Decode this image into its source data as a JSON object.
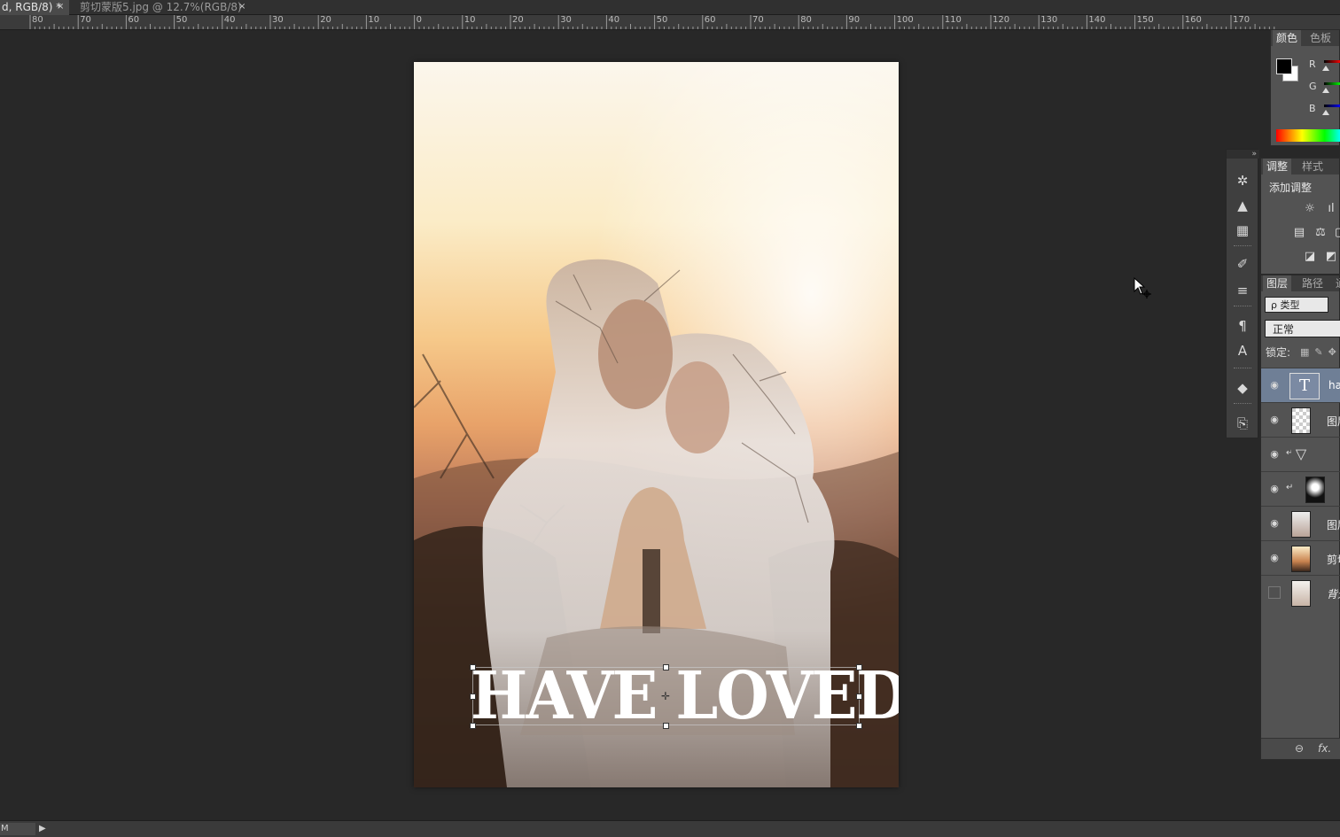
{
  "tabs": [
    {
      "label": "d, RGB/8) *",
      "close": "×"
    },
    {
      "label": "剪切蒙版5.jpg @ 12.7%(RGB/8)",
      "close": "×"
    }
  ],
  "ruler": {
    "labels": [
      "80",
      "70",
      "60",
      "50",
      "40",
      "30",
      "20",
      "10",
      "0",
      "10",
      "20",
      "30",
      "40",
      "50",
      "60",
      "70",
      "80",
      "90",
      "100",
      "110",
      "120",
      "130",
      "140",
      "150",
      "160",
      "170"
    ]
  },
  "canvas": {
    "overlay_text": "HAVE LOVED"
  },
  "status": {
    "zoom": "M"
  },
  "color_panel": {
    "tabs": [
      "颜色",
      "色板"
    ],
    "channels": [
      "R",
      "G",
      "B"
    ]
  },
  "adjust_panel": {
    "tabs": [
      "调整",
      "样式"
    ],
    "title": "添加调整"
  },
  "layers_panel": {
    "tabs": [
      "图层",
      "路径",
      "通"
    ],
    "kind": "ρ 类型",
    "blend_mode": "正常",
    "lock_label": "锁定:",
    "layers": [
      {
        "name": "hav",
        "type": "text",
        "visible": true,
        "selected": true
      },
      {
        "name": "图层",
        "type": "image",
        "visible": true
      },
      {
        "name": "",
        "type": "adjustment",
        "visible": true,
        "clipped": true
      },
      {
        "name": "",
        "type": "masked",
        "visible": true,
        "clipped": true
      },
      {
        "name": "图层",
        "type": "image",
        "visible": true
      },
      {
        "name": "剪切",
        "type": "smart",
        "visible": true
      },
      {
        "name": "背景",
        "type": "background",
        "visible": false
      }
    ],
    "footer": {
      "link": "⊖",
      "fx": "fx."
    }
  },
  "colors": {
    "background": "#282828",
    "panel": "#535353",
    "selected_layer": "#6f7f96"
  }
}
